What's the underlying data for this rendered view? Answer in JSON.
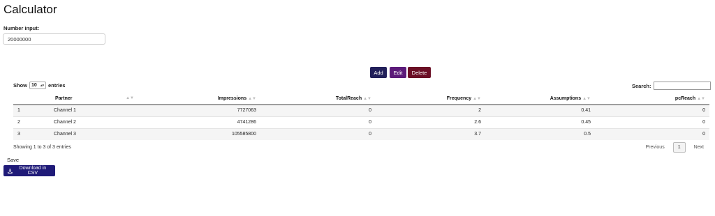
{
  "page": {
    "title": "Calculator"
  },
  "number_input": {
    "label": "Number input:",
    "value": "20000000"
  },
  "actions": {
    "add": "Add",
    "edit": "Edit",
    "delete": "Delete"
  },
  "length": {
    "show": "Show",
    "value": "10",
    "entries": "entries"
  },
  "search": {
    "label": "Search:"
  },
  "table": {
    "columns": [
      "",
      "Partner",
      "Impressions",
      "TotalReach",
      "Frequency",
      "Assumptions",
      "pcReach"
    ],
    "rows": [
      [
        "1",
        "Channel 1",
        "7727063",
        "0",
        "2",
        "0.41",
        "0"
      ],
      [
        "2",
        "Channel 2",
        "4741286",
        "0",
        "2.6",
        "0.45",
        "0"
      ],
      [
        "3",
        "Channel 3",
        "105585800",
        "0",
        "3.7",
        "0.5",
        "0"
      ]
    ]
  },
  "info": "Showing 1 to 3 of 3 entries",
  "pagination": {
    "previous": "Previous",
    "current": "1",
    "next": "Next"
  },
  "save": {
    "label": "Save",
    "download": "Download in CSV"
  },
  "icons": {
    "download": "download-icon",
    "sort": "sort-icon"
  },
  "colors": {
    "add": "#22205a",
    "edit": "#5c1b7a",
    "delete": "#6b0f26",
    "download": "#1f1a78"
  }
}
